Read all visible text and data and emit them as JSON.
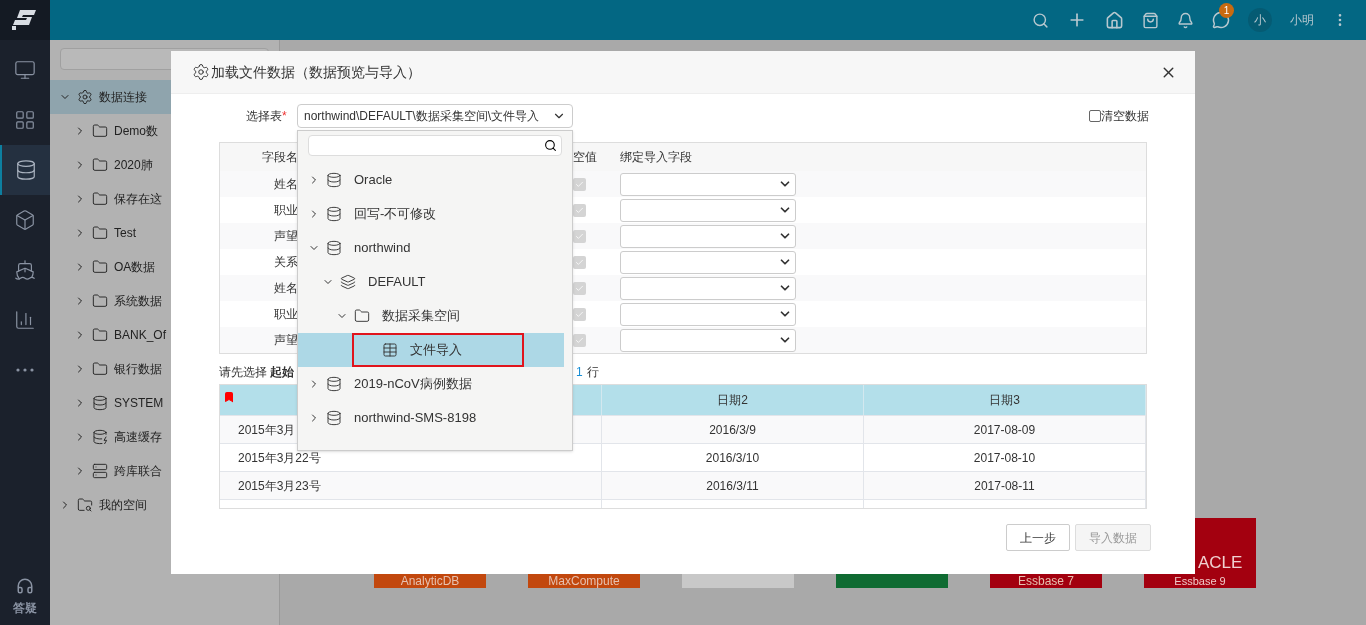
{
  "top_bar": {
    "message_badge": "1",
    "avatar": "小",
    "user_name": "小明"
  },
  "nav": {
    "items": [
      {
        "kind": "monitor",
        "selected": false
      },
      {
        "kind": "apps",
        "selected": false
      },
      {
        "kind": "database",
        "selected": true
      },
      {
        "kind": "cube",
        "selected": false
      },
      {
        "kind": "ship",
        "selected": false
      },
      {
        "kind": "chart",
        "selected": false
      },
      {
        "kind": "more",
        "selected": false
      }
    ],
    "help_label": "答疑"
  },
  "tree": {
    "items": [
      {
        "label": "数据连接",
        "kind": "connection",
        "expanded": true,
        "selected": true,
        "children": [
          {
            "label": "Demo数",
            "kind": "folder",
            "expanded": false,
            "selected": false
          },
          {
            "label": "2020肺",
            "kind": "folder",
            "expanded": false,
            "selected": false
          },
          {
            "label": "保存在这",
            "kind": "folder",
            "expanded": false,
            "selected": false
          },
          {
            "label": "Test",
            "kind": "folder",
            "expanded": false,
            "selected": false
          },
          {
            "label": "OA数据",
            "kind": "folder",
            "expanded": false,
            "selected": false
          },
          {
            "label": "系统数据",
            "kind": "folder",
            "expanded": false,
            "selected": false
          },
          {
            "label": "BANK_Of",
            "kind": "folder",
            "expanded": false,
            "selected": false
          },
          {
            "label": "银行数据",
            "kind": "folder",
            "expanded": false,
            "selected": false
          },
          {
            "label": "SYSTEM",
            "kind": "database",
            "expanded": false,
            "selected": false
          },
          {
            "label": "高速缓存",
            "kind": "cache",
            "expanded": false,
            "selected": false
          },
          {
            "label": "跨库联合",
            "kind": "federated",
            "expanded": false,
            "selected": false
          }
        ]
      },
      {
        "label": "我的空间",
        "kind": "space",
        "expanded": false,
        "selected": false
      }
    ]
  },
  "tiles": [
    {
      "label": "AnalyticDB",
      "color": "#c2480e"
    },
    {
      "label": "MaxCompute",
      "color": "#c2480e"
    },
    {
      "color": "#c8c8c8"
    },
    {
      "color": "#0f6b32"
    },
    {
      "label": "Essbase 7",
      "color": "#a3000f"
    },
    {
      "label": "Essbase 9",
      "brand": "ACLE",
      "color": "#a3000f"
    }
  ],
  "dialog": {
    "title": "加载文件数据（数据预览与导入）",
    "table_label": "选择表",
    "required_mark": "*",
    "table_value": "northwind\\DEFAULT\\数据采集空间\\文件导入",
    "clear_data": {
      "label": "清空数据",
      "checked": false
    },
    "mapping": {
      "columns": [
        "字段名",
        "空值",
        "绑定导入字段"
      ],
      "rows": [
        {
          "field": "姓名",
          "allow_null": true
        },
        {
          "field": "职业",
          "allow_null": true
        },
        {
          "field": "声望",
          "allow_null": true
        },
        {
          "field": "关系",
          "allow_null": true
        },
        {
          "field": "姓名",
          "allow_null": true
        },
        {
          "field": "职业",
          "allow_null": true
        },
        {
          "field": "声望",
          "allow_null": true
        }
      ]
    },
    "hint": "请先选择 **起始**",
    "row_count": "1",
    "row_unit": "行",
    "preview": {
      "columns": [
        "",
        "日期2",
        "日期3"
      ],
      "rows": [
        [
          "2015年3月",
          "2016/3/9",
          "2017-08-09"
        ],
        [
          "2015年3月22号",
          "2016/3/10",
          "2017-08-10"
        ],
        [
          "2015年3月23号",
          "2016/3/11",
          "2017-08-11"
        ]
      ]
    },
    "buttons": [
      {
        "label": "上一步",
        "disabled": false
      },
      {
        "label": "导入数据",
        "disabled": true
      }
    ]
  },
  "dropdown": {
    "items": [
      {
        "label": "Oracle",
        "kind": "database",
        "expanded": false,
        "selected": false
      },
      {
        "label": "回写-不可修改",
        "kind": "database",
        "expanded": false,
        "selected": false
      },
      {
        "label": "northwind",
        "kind": "database",
        "expanded": true,
        "selected": false,
        "children": [
          {
            "label": "DEFAULT",
            "kind": "schema",
            "expanded": true,
            "selected": false,
            "children": [
              {
                "label": "数据采集空间",
                "kind": "folder",
                "expanded": true,
                "selected": false,
                "children": [
                  {
                    "label": "文件导入",
                    "kind": "table",
                    "selected": true
                  }
                ]
              }
            ]
          }
        ]
      },
      {
        "label": "2019-nCoV病例数据",
        "kind": "database",
        "expanded": false,
        "selected": false
      },
      {
        "label": "northwind-SMS-8198",
        "kind": "database",
        "expanded": false,
        "selected": false
      }
    ]
  }
}
